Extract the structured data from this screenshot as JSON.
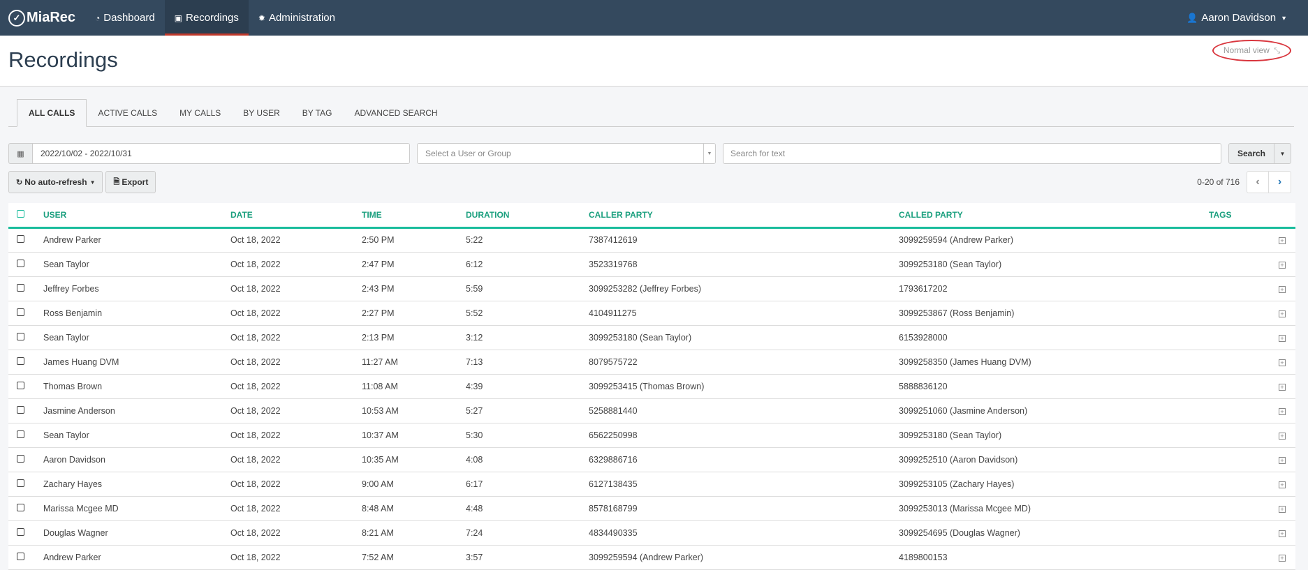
{
  "nav": {
    "brand": "MiaRec",
    "items": [
      {
        "label": "Dashboard",
        "icon": "dashboard-icon",
        "glyph": "◔"
      },
      {
        "label": "Recordings",
        "icon": "play-square-icon",
        "glyph": "▶"
      },
      {
        "label": "Administration",
        "icon": "gear-icon",
        "glyph": "✹"
      }
    ],
    "user": "Aaron Davidson"
  },
  "header": {
    "title": "Recordings",
    "normal_view": "Normal view"
  },
  "tabs": [
    "ALL CALLS",
    "ACTIVE CALLS",
    "MY CALLS",
    "BY USER",
    "BY TAG",
    "ADVANCED SEARCH"
  ],
  "filters": {
    "date_range": "2022/10/02 - 2022/10/31",
    "user_placeholder": "Select a User or Group",
    "search_placeholder": "Search for text",
    "search_label": "Search"
  },
  "toolbar": {
    "refresh_label": "No auto-refresh",
    "export_label": "Export",
    "pager_text": "0-20 of 716"
  },
  "table": {
    "columns": [
      "USER",
      "DATE",
      "TIME",
      "DURATION",
      "CALLER PARTY",
      "CALLED PARTY",
      "TAGS"
    ],
    "rows": [
      {
        "user": "Andrew Parker",
        "date": "Oct 18, 2022",
        "time": "2:50 PM",
        "duration": "5:22",
        "caller": "7387412619",
        "called": "3099259594 (Andrew Parker)"
      },
      {
        "user": "Sean Taylor",
        "date": "Oct 18, 2022",
        "time": "2:47 PM",
        "duration": "6:12",
        "caller": "3523319768",
        "called": "3099253180 (Sean Taylor)"
      },
      {
        "user": "Jeffrey Forbes",
        "date": "Oct 18, 2022",
        "time": "2:43 PM",
        "duration": "5:59",
        "caller": "3099253282 (Jeffrey Forbes)",
        "called": "1793617202"
      },
      {
        "user": "Ross Benjamin",
        "date": "Oct 18, 2022",
        "time": "2:27 PM",
        "duration": "5:52",
        "caller": "4104911275",
        "called": "3099253867 (Ross Benjamin)"
      },
      {
        "user": "Sean Taylor",
        "date": "Oct 18, 2022",
        "time": "2:13 PM",
        "duration": "3:12",
        "caller": "3099253180 (Sean Taylor)",
        "called": "6153928000"
      },
      {
        "user": "James Huang DVM",
        "date": "Oct 18, 2022",
        "time": "11:27 AM",
        "duration": "7:13",
        "caller": "8079575722",
        "called": "3099258350 (James Huang DVM)"
      },
      {
        "user": "Thomas Brown",
        "date": "Oct 18, 2022",
        "time": "11:08 AM",
        "duration": "4:39",
        "caller": "3099253415 (Thomas Brown)",
        "called": "5888836120"
      },
      {
        "user": "Jasmine Anderson",
        "date": "Oct 18, 2022",
        "time": "10:53 AM",
        "duration": "5:27",
        "caller": "5258881440",
        "called": "3099251060 (Jasmine Anderson)"
      },
      {
        "user": "Sean Taylor",
        "date": "Oct 18, 2022",
        "time": "10:37 AM",
        "duration": "5:30",
        "caller": "6562250998",
        "called": "3099253180 (Sean Taylor)"
      },
      {
        "user": "Aaron Davidson",
        "date": "Oct 18, 2022",
        "time": "10:35 AM",
        "duration": "4:08",
        "caller": "6329886716",
        "called": "3099252510 (Aaron Davidson)"
      },
      {
        "user": "Zachary Hayes",
        "date": "Oct 18, 2022",
        "time": "9:00 AM",
        "duration": "6:17",
        "caller": "6127138435",
        "called": "3099253105 (Zachary Hayes)"
      },
      {
        "user": "Marissa Mcgee MD",
        "date": "Oct 18, 2022",
        "time": "8:48 AM",
        "duration": "4:48",
        "caller": "8578168799",
        "called": "3099253013 (Marissa Mcgee MD)"
      },
      {
        "user": "Douglas Wagner",
        "date": "Oct 18, 2022",
        "time": "8:21 AM",
        "duration": "7:24",
        "caller": "4834490335",
        "called": "3099254695 (Douglas Wagner)"
      },
      {
        "user": "Andrew Parker",
        "date": "Oct 18, 2022",
        "time": "7:52 AM",
        "duration": "3:57",
        "caller": "3099259594 (Andrew Parker)",
        "called": "4189800153"
      }
    ]
  },
  "colors": {
    "nav_bg": "#34495e",
    "accent_green": "#1abc9c",
    "active_tab_underline": "#c0392b",
    "annotation_circle": "#d9363e"
  }
}
